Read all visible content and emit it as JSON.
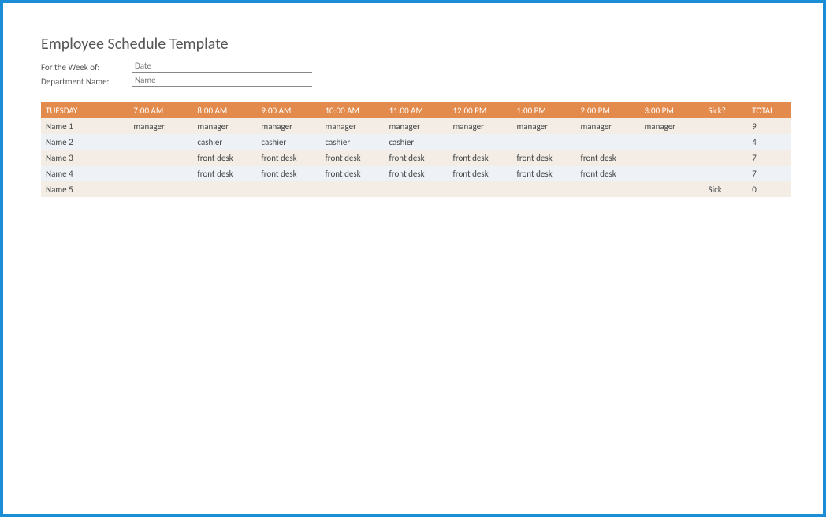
{
  "title": "Employee Schedule Template",
  "meta": {
    "week_label": "For the Week of:",
    "week_value": "Date",
    "dept_label": "Department Name:",
    "dept_value": "Name"
  },
  "headers": {
    "day": "TUESDAY",
    "times": [
      "7:00 AM",
      "8:00 AM",
      "9:00 AM",
      "10:00 AM",
      "11:00 AM",
      "12:00 PM",
      "1:00 PM",
      "2:00 PM",
      "3:00 PM"
    ],
    "sick": "Sick?",
    "total": "TOTAL"
  },
  "rows": [
    {
      "name": "Name 1",
      "cells": [
        "manager",
        "manager",
        "manager",
        "manager",
        "manager",
        "manager",
        "manager",
        "manager",
        "manager"
      ],
      "sick": "",
      "total": "9"
    },
    {
      "name": "Name 2",
      "cells": [
        "",
        "cashier",
        "cashier",
        "cashier",
        "cashier",
        "",
        "",
        "",
        ""
      ],
      "sick": "",
      "total": "4"
    },
    {
      "name": "Name 3",
      "cells": [
        "",
        "front desk",
        "front desk",
        "front desk",
        "front desk",
        "front desk",
        "front desk",
        "front desk",
        ""
      ],
      "sick": "",
      "total": "7"
    },
    {
      "name": "Name 4",
      "cells": [
        "",
        "front desk",
        "front desk",
        "front desk",
        "front desk",
        "front desk",
        "front desk",
        "front desk",
        ""
      ],
      "sick": "",
      "total": "7"
    },
    {
      "name": "Name 5",
      "cells": [
        "",
        "",
        "",
        "",
        "",
        "",
        "",
        "",
        ""
      ],
      "sick": "Sick",
      "total": "0"
    }
  ]
}
